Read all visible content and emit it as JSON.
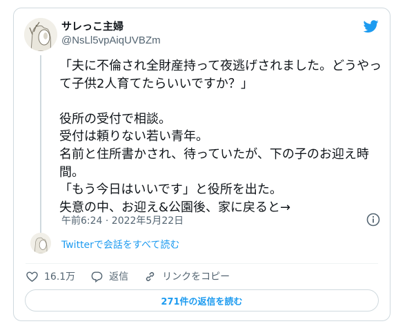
{
  "tweet": {
    "author_name": "サレっこ主婦",
    "author_handle": "@NsLl5vpAiqUVBZm",
    "text": "「夫に不倫され全財産持って夜逃げされました。どうやって子供2人育てたらいいですか？」\n\n役所の受付で相談。\n受付は頼りない若い青年。\n名前と住所書かされ、待っていたが、下の子のお迎え時間。\n「もう今日はいいです」と役所を出た。\n失意の中、お迎え&公園後、家に戻ると→",
    "timestamp": "午前6:24 · 2022年5月22日",
    "conversation_link": "Twitterで会話をすべて読む"
  },
  "actions": {
    "likes": "16.1万",
    "reply_label": "返信",
    "copy_link_label": "リンクをコピー"
  },
  "read_replies_button": "271件の返信を読む",
  "colors": {
    "accent": "#1d9bf0",
    "secondary_text": "#536471",
    "border": "#cfd9de"
  },
  "icons": [
    "twitter-bird-icon",
    "info-icon",
    "heart-icon",
    "reply-icon",
    "link-icon"
  ]
}
